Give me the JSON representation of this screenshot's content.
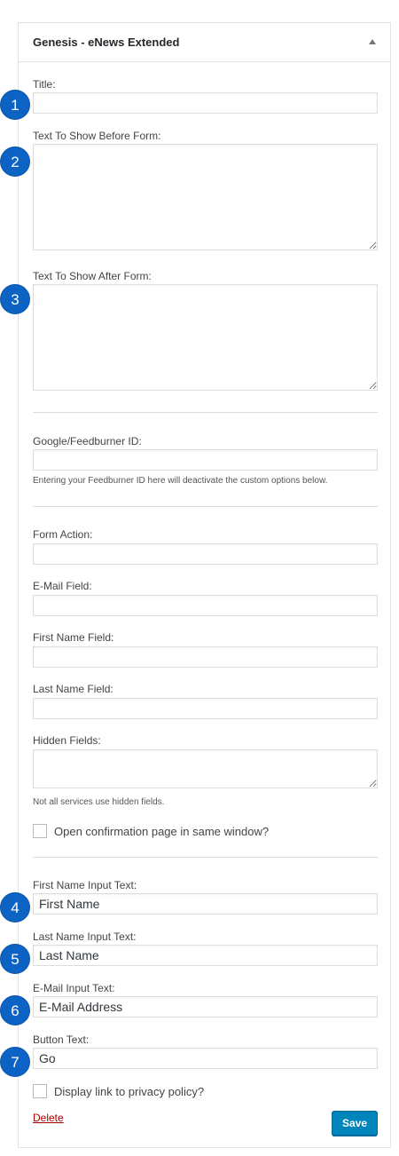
{
  "widget": {
    "title": "Genesis - eNews Extended"
  },
  "badges": [
    "1",
    "2",
    "3",
    "4",
    "5",
    "6",
    "7"
  ],
  "fields": {
    "title_label": "Title:",
    "before_label": "Text To Show Before Form:",
    "after_label": "Text To Show After Form:",
    "feedburner_label": "Google/Feedburner ID:",
    "feedburner_help": "Entering your Feedburner ID here will deactivate the custom options below.",
    "form_action_label": "Form Action:",
    "email_field_label": "E-Mail Field:",
    "first_name_field_label": "First Name Field:",
    "last_name_field_label": "Last Name Field:",
    "hidden_fields_label": "Hidden Fields:",
    "hidden_fields_help": "Not all services use hidden fields.",
    "open_same_window_label": "Open confirmation page in same window?",
    "first_name_input_label": "First Name Input Text:",
    "first_name_input_value": "First Name",
    "last_name_input_label": "Last Name Input Text:",
    "last_name_input_value": "Last Name",
    "email_input_label": "E-Mail Input Text:",
    "email_input_value": "E-Mail Address",
    "button_text_label": "Button Text:",
    "button_text_value": "Go",
    "privacy_label": "Display link to privacy policy?"
  },
  "actions": {
    "delete_label": "Delete",
    "save_label": "Save"
  },
  "colors": {
    "badge": "#0c63c4",
    "save_button": "#0085ba",
    "delete_link": "#aa0000"
  }
}
